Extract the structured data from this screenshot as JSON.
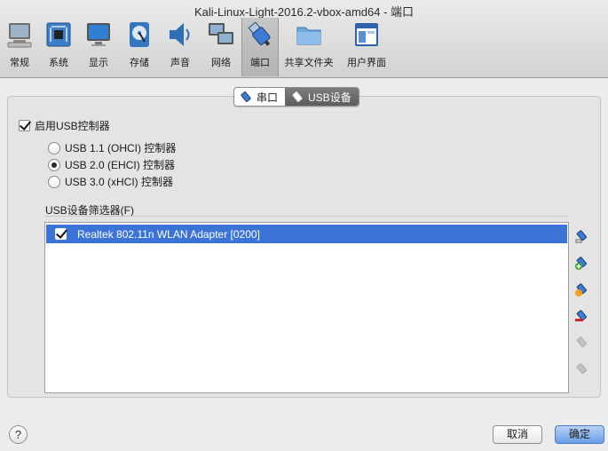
{
  "window": {
    "title": "Kali-Linux-Light-2016.2-vbox-amd64 - 端口"
  },
  "toolbar": {
    "items": [
      {
        "label": "常规",
        "icon": "monitor-general-icon"
      },
      {
        "label": "系统",
        "icon": "chip-icon"
      },
      {
        "label": "显示",
        "icon": "display-icon"
      },
      {
        "label": "存储",
        "icon": "disk-icon"
      },
      {
        "label": "声音",
        "icon": "speaker-icon"
      },
      {
        "label": "网络",
        "icon": "network-icon"
      },
      {
        "label": "端口",
        "icon": "usb-plug-icon"
      },
      {
        "label": "共享文件夹",
        "icon": "folder-icon"
      },
      {
        "label": "用户界面",
        "icon": "window-icon"
      }
    ],
    "active": "端口"
  },
  "tabs": {
    "serial": "串口",
    "usb": "USB设备",
    "selected": "USB设备"
  },
  "usb": {
    "enable_label": "启用USB控制器",
    "enable_checked": true,
    "options": [
      "USB 1.1 (OHCI) 控制器",
      "USB 2.0 (EHCI) 控制器",
      "USB 3.0 (xHCI) 控制器"
    ],
    "selected_option": "USB 2.0 (EHCI) 控制器",
    "filters_label": "USB设备筛选器(F)",
    "filters": [
      {
        "name": "Realtek 802.11n WLAN Adapter [0200]",
        "checked": true
      }
    ]
  },
  "side_buttons": [
    "add-filter-icon",
    "add-from-device-icon",
    "edit-filter-icon",
    "remove-filter-icon",
    "move-up-icon",
    "move-down-icon"
  ],
  "footer": {
    "help": "?",
    "cancel": "取消",
    "ok": "确定"
  },
  "colors": {
    "selection": "#3b73d7",
    "accent": "#3d7bd4"
  }
}
